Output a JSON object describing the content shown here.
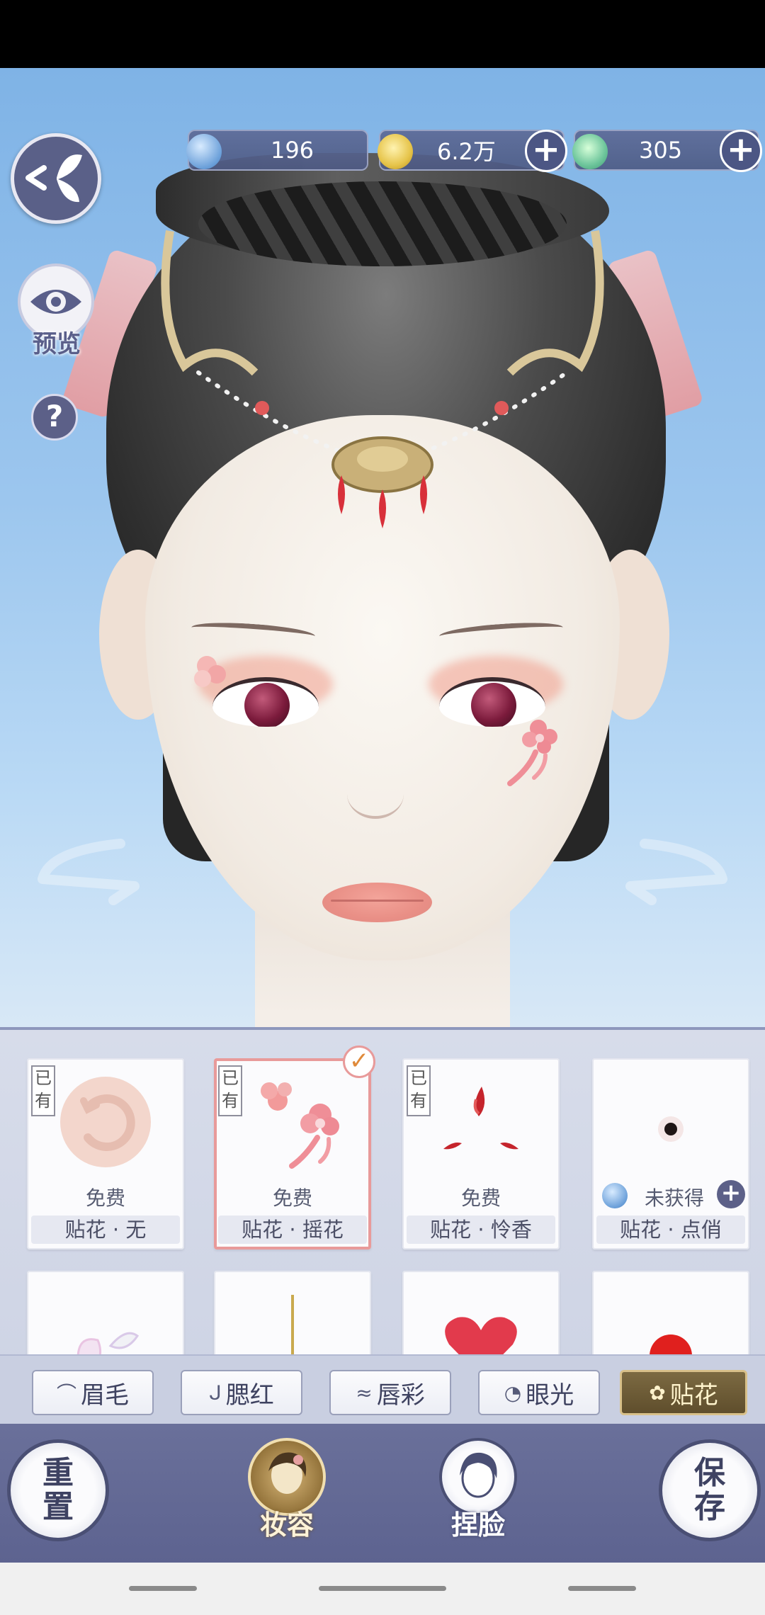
{
  "currencies": {
    "jade": {
      "value": "196",
      "icon": "jade-token-icon"
    },
    "gold": {
      "value": "6.2万",
      "icon": "coin-icon"
    },
    "energy": {
      "value": "305",
      "icon": "energy-swirl-icon"
    }
  },
  "left_tools": {
    "preview_label": "预览",
    "help_label": "?"
  },
  "items": [
    {
      "owned": "已有",
      "price": "免费",
      "name": "贴花 · 无",
      "selected": false
    },
    {
      "owned": "已有",
      "price": "免费",
      "name": "贴花 · 摇花",
      "selected": true
    },
    {
      "owned": "已有",
      "price": "免费",
      "name": "贴花 · 怜香",
      "selected": false
    },
    {
      "owned": "",
      "price": "未获得",
      "name": "贴花 · 点俏",
      "selected": false
    }
  ],
  "category_tabs": [
    {
      "label": "眉毛",
      "icon": "brow-icon",
      "active": false
    },
    {
      "label": "腮红",
      "icon": "brush-icon",
      "active": false
    },
    {
      "label": "唇彩",
      "icon": "lips-icon",
      "active": false
    },
    {
      "label": "眼光",
      "icon": "eye-light-icon",
      "active": false
    },
    {
      "label": "贴花",
      "icon": "flower-icon",
      "active": true
    }
  ],
  "bottom_nav": {
    "reset_top": "重",
    "reset_bottom": "置",
    "makeup_label": "妆容",
    "face_label": "捏脸",
    "save_top": "保",
    "save_bottom": "存"
  },
  "colors": {
    "accent_gold": "#d8c089",
    "panel_bg": "#d7dcea",
    "nav_bg": "#6a709a",
    "selected_border": "#e89a9a"
  }
}
